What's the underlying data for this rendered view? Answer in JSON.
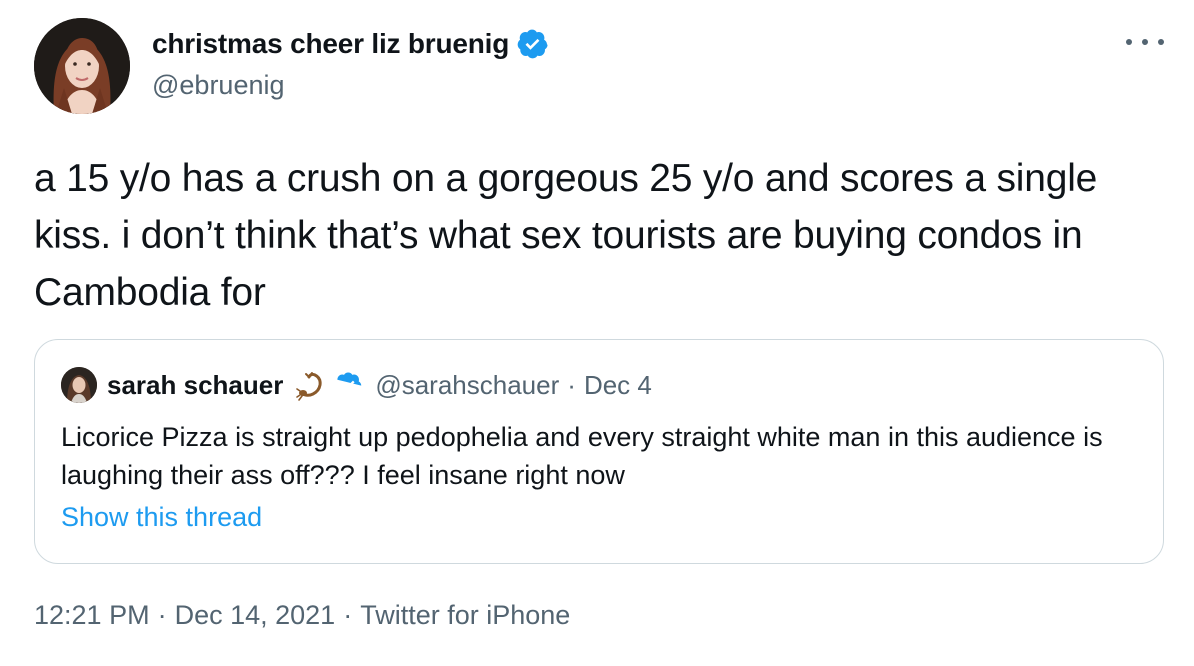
{
  "tweet": {
    "author": {
      "display_name": "christmas cheer liz bruenig",
      "handle": "@ebruenig",
      "verified": true,
      "avatar_icon": "portrait-avatar"
    },
    "text": "a 15 y/o has a crush on a gorgeous 25 y/o and scores a single kiss. i don’t think that’s what sex tourists are buying condos in Cambodia for",
    "more_icon": "ellipsis-icon",
    "quoted": {
      "display_name": "sarah schauer",
      "emoji_icon": "scorpion-icon",
      "verified": true,
      "handle": "@sarahschauer",
      "separator": "·",
      "date": "Dec 4",
      "text": "Licorice Pizza is straight up pedophelia and every straight white man in this audience is laughing their ass off??? I feel insane right now",
      "show_thread": "Show this thread"
    },
    "meta": {
      "time": "12:21 PM",
      "date": "Dec 14, 2021",
      "source": "Twitter for iPhone",
      "separator": "·"
    }
  },
  "colors": {
    "text_primary": "#0f1419",
    "text_secondary": "#536471",
    "link": "#1d9bf0",
    "verified": "#1d9bf0",
    "border": "#cfd9de"
  }
}
